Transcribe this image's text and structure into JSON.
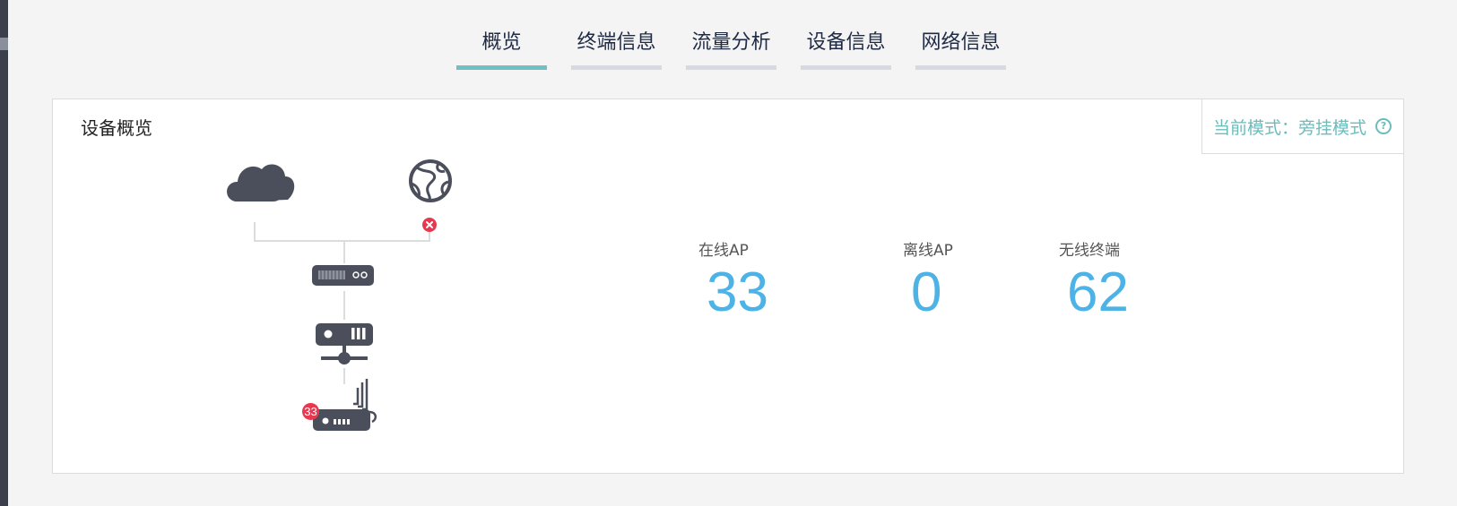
{
  "tabs": [
    {
      "label": "概览",
      "active": true
    },
    {
      "label": "终端信息",
      "active": false
    },
    {
      "label": "流量分析",
      "active": false
    },
    {
      "label": "设备信息",
      "active": false
    },
    {
      "label": "网络信息",
      "active": false
    }
  ],
  "panel": {
    "title": "设备概览",
    "mode_text": "当前模式：旁挂模式",
    "mode_help_glyph": "?"
  },
  "topology": {
    "icons": [
      "cloud-icon",
      "globe-icon",
      "error-badge-icon",
      "gateway-icon",
      "switch-icon",
      "wireless-ap-icon"
    ],
    "ap_badge": "33"
  },
  "stats": {
    "online_ap": {
      "label": "在线AP",
      "value": "33"
    },
    "offline_ap": {
      "label": "离线AP",
      "value": "0"
    },
    "wireless_clients": {
      "label": "无线终端",
      "value": "62"
    }
  },
  "colors": {
    "accent": "#6ec0c2",
    "value_blue": "#4db3e6",
    "icon_gray": "#4b4f5c",
    "error_red": "#e8384f"
  }
}
